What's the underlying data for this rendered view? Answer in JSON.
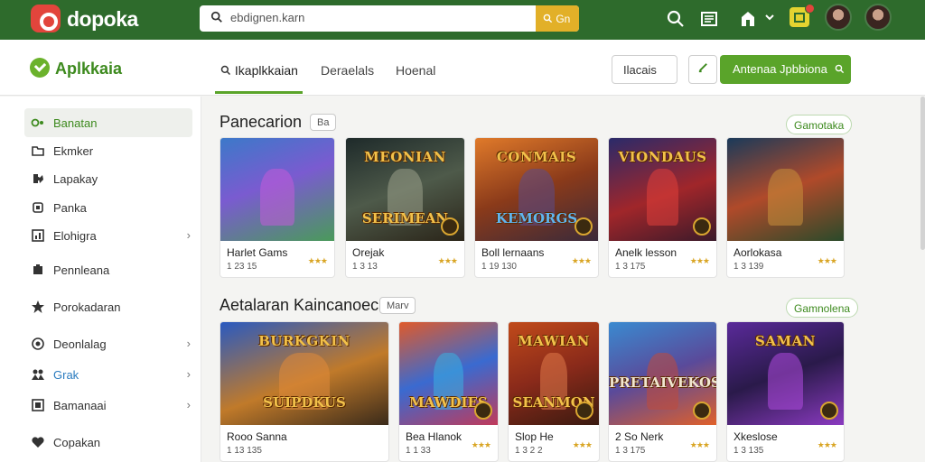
{
  "topbar": {
    "logo": "dopoka",
    "search_value": "ebdignen.karn",
    "search_button": "Gn",
    "colors": {
      "bar": "#2e6b2c",
      "accent": "#e2b028",
      "logo": "#e2453c"
    }
  },
  "header": {
    "brand": "Aplkkaia",
    "tabs": [
      {
        "label": "Ikaplkkaian"
      },
      {
        "label": "Deraelals"
      },
      {
        "label": "Hoenal"
      }
    ],
    "filter_button": "Ilacais",
    "primary_button": "Antenaa Jpbbiona"
  },
  "sidebar": {
    "items": [
      {
        "label": "Banatan",
        "icon": "gamepad-icon"
      },
      {
        "label": "Ekmker",
        "icon": "folder-icon"
      },
      {
        "label": "Lapakay",
        "icon": "puzzle-icon"
      },
      {
        "label": "Panka",
        "icon": "square-icon"
      },
      {
        "label": "Elohigra",
        "icon": "chart-icon"
      },
      {
        "label": "Pennleana",
        "icon": "trophy-icon"
      },
      {
        "label": "Porokadaran",
        "icon": "star-icon"
      },
      {
        "label": "Deonlalag",
        "icon": "target-icon"
      },
      {
        "label": "Grak",
        "icon": "group-icon"
      },
      {
        "label": "Bamanaai",
        "icon": "box-icon"
      },
      {
        "label": "Copakan",
        "icon": "heart-icon"
      }
    ]
  },
  "sections": [
    {
      "title": "Panecarion",
      "pill": "Ba",
      "see_all": "Gamotaka",
      "cards": [
        {
          "name": "Harlet Gams",
          "meta": "1 23 15",
          "thumb_title": "",
          "thumb_sub": ""
        },
        {
          "name": "Orejak",
          "meta": "1 3 13",
          "thumb_title": "MEONIAN",
          "thumb_sub": "SERIMEAN"
        },
        {
          "name": "Boll lernaans",
          "meta": "1 19 130",
          "thumb_title": "CONMAIS",
          "thumb_sub": "KEMORGS"
        },
        {
          "name": "Anelk lesson",
          "meta": "1 3 175",
          "thumb_title": "VIONDAUS",
          "thumb_sub": ""
        },
        {
          "name": "Aorlokasa",
          "meta": "1 3 139",
          "thumb_title": "",
          "thumb_sub": ""
        }
      ]
    },
    {
      "title": "Aetalaran Kaincanoec",
      "pill": "Marv",
      "see_all": "Gamnolena",
      "cards": [
        {
          "name": "Rooo Sanna",
          "meta": "1 13 135",
          "thumb_title": "BURKGKIN",
          "thumb_sub": "SUIPDKUS"
        },
        {
          "name": "Bea Hlanok",
          "meta": "1 1 33",
          "thumb_title": "",
          "thumb_sub": "MAWDIES"
        },
        {
          "name": "Slop He",
          "meta": "1 3 2 2",
          "thumb_title": "MAWIAN",
          "thumb_sub": "SEANMON"
        },
        {
          "name": "2 So Nerk",
          "meta": "1 3 175",
          "thumb_title": "",
          "thumb_sub": "PRETAIVEKOS"
        },
        {
          "name": "Xkeslose",
          "meta": "1 3 135",
          "thumb_title": "SAMAN",
          "thumb_sub": ""
        }
      ]
    }
  ]
}
